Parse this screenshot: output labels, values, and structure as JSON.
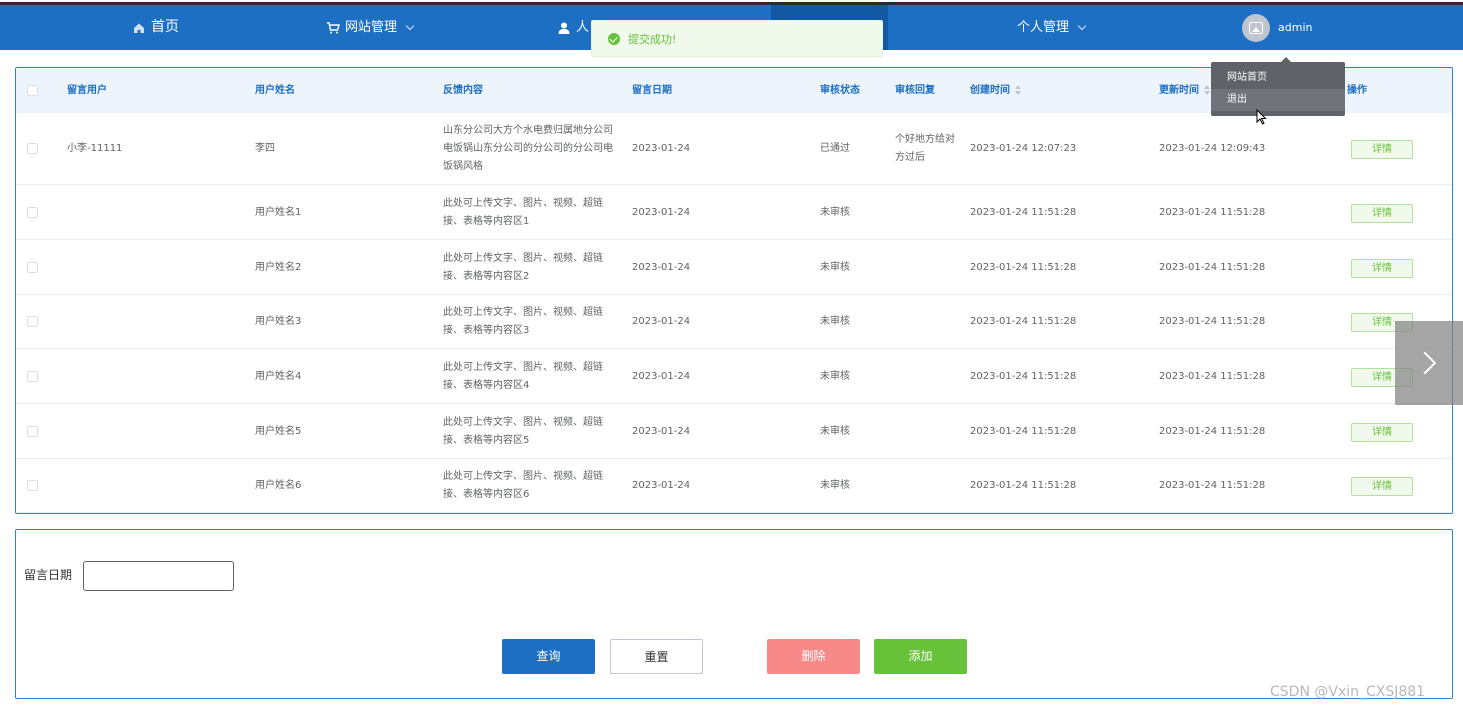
{
  "nav": {
    "home": "首页",
    "site_manage": "网站管理",
    "person_partial": "人",
    "personal_manage": "个人管理",
    "username": "admin"
  },
  "toast": {
    "message": "提交成功!"
  },
  "dropdown": {
    "items": [
      "网站首页",
      "退出"
    ]
  },
  "table": {
    "headers": {
      "msg_user": "留言用户",
      "user_name": "用户姓名",
      "feedback": "反馈内容",
      "msg_date": "留言日期",
      "review_status": "审核状态",
      "review_reply": "审核回复",
      "created_at": "创建时间",
      "updated_at": "更新时间",
      "actions": "操作"
    },
    "rows": [
      {
        "msg_user": "小李-11111",
        "user_name": "李四",
        "feedback": "山东分公司大方个水电费归属地分公司电饭锅山东分公司的分公司的分公司电饭锅风格",
        "msg_date": "2023-01-24",
        "review_status": "已通过",
        "review_reply": "个好地方给对方过后",
        "created_at": "2023-01-24 12:07:23",
        "updated_at": "2023-01-24 12:09:43",
        "action": "详情"
      },
      {
        "msg_user": "",
        "user_name": "用户姓名1",
        "feedback": "此处可上传文字、图片、视频、超链接、表格等内容区1",
        "msg_date": "2023-01-24",
        "review_status": "未审核",
        "review_reply": "",
        "created_at": "2023-01-24 11:51:28",
        "updated_at": "2023-01-24 11:51:28",
        "action": "详情"
      },
      {
        "msg_user": "",
        "user_name": "用户姓名2",
        "feedback": "此处可上传文字、图片、视频、超链接、表格等内容区2",
        "msg_date": "2023-01-24",
        "review_status": "未审核",
        "review_reply": "",
        "created_at": "2023-01-24 11:51:28",
        "updated_at": "2023-01-24 11:51:28",
        "action": "详情"
      },
      {
        "msg_user": "",
        "user_name": "用户姓名3",
        "feedback": "此处可上传文字、图片、视频、超链接、表格等内容区3",
        "msg_date": "2023-01-24",
        "review_status": "未审核",
        "review_reply": "",
        "created_at": "2023-01-24 11:51:28",
        "updated_at": "2023-01-24 11:51:28",
        "action": "详情"
      },
      {
        "msg_user": "",
        "user_name": "用户姓名4",
        "feedback": "此处可上传文字、图片、视频、超链接、表格等内容区4",
        "msg_date": "2023-01-24",
        "review_status": "未审核",
        "review_reply": "",
        "created_at": "2023-01-24 11:51:28",
        "updated_at": "2023-01-24 11:51:28",
        "action": "详情"
      },
      {
        "msg_user": "",
        "user_name": "用户姓名5",
        "feedback": "此处可上传文字、图片、视频、超链接、表格等内容区5",
        "msg_date": "2023-01-24",
        "review_status": "未审核",
        "review_reply": "",
        "created_at": "2023-01-24 11:51:28",
        "updated_at": "2023-01-24 11:51:28",
        "action": "详情"
      },
      {
        "msg_user": "",
        "user_name": "用户姓名6",
        "feedback": "此处可上传文字、图片、视频、超链接、表格等内容区6",
        "msg_date": "2023-01-24",
        "review_status": "未审核",
        "review_reply": "",
        "created_at": "2023-01-24 11:51:28",
        "updated_at": "2023-01-24 11:51:28",
        "action": "详情"
      }
    ]
  },
  "search": {
    "date_label": "留言日期",
    "date_value": "",
    "query": "查询",
    "reset": "重置",
    "delete": "删除",
    "add": "添加"
  },
  "watermark": "CSDN @Vxin_CXSJ881",
  "colors": {
    "nav": "#1c6fc2",
    "success": "#67c23a",
    "danger": "#f78989"
  }
}
